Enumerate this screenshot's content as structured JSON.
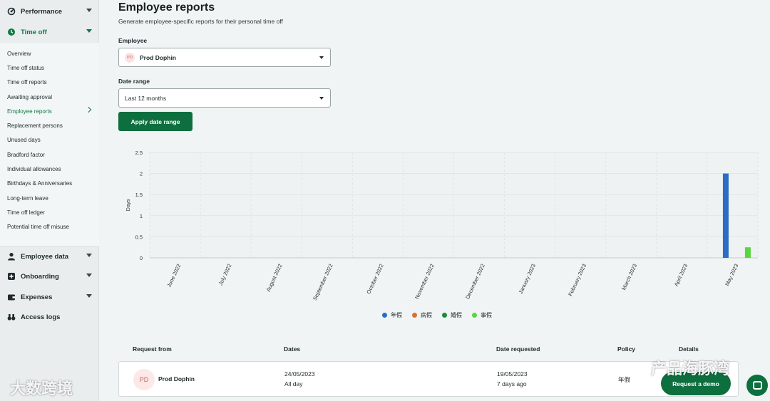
{
  "sidebar": {
    "sections_top": [
      {
        "label": "Performance",
        "icon": "performance-icon"
      },
      {
        "label": "Time off",
        "icon": "clock-icon"
      }
    ],
    "sub_items": [
      "Overview",
      "Time off status",
      "Time off reports",
      "Awaiting approval",
      "Employee reports",
      "Replacement persons",
      "Unused days",
      "Bradford factor",
      "Individual allowances",
      "Birthdays & Anniversaries",
      "Long-term leave",
      "Time off ledger",
      "Potential time off misuse"
    ],
    "active_sub_index": 4,
    "sections_bottom": [
      {
        "label": "Employee data",
        "icon": "person-icon"
      },
      {
        "label": "Onboarding",
        "icon": "plus-icon"
      },
      {
        "label": "Expenses",
        "icon": "wallet-icon"
      },
      {
        "label": "Access logs",
        "icon": "binoculars-icon"
      }
    ]
  },
  "page": {
    "title": "Employee reports",
    "subtitle": "Generate employee-specific reports for their personal time off"
  },
  "employee_field": {
    "label": "Employee",
    "avatar_initials": "PD",
    "value": "Prod Dophin"
  },
  "date_range_field": {
    "label": "Date range",
    "value": "Last 12 months"
  },
  "apply_button": "Apply date range",
  "chart_data": {
    "type": "bar",
    "ylabel": "Days",
    "ylim": [
      0,
      2.5
    ],
    "yticks": [
      "0",
      "0.5",
      "1",
      "1.5",
      "2",
      "2.5"
    ],
    "categories": [
      "June 2022",
      "July 2022",
      "August 2022",
      "September 2022",
      "October 2022",
      "November 2022",
      "December 2022",
      "January 2023",
      "February 2023",
      "March 2023",
      "April 2023",
      "May 2023"
    ],
    "series": [
      {
        "name": "年假",
        "color": "#2b6cc4",
        "values": [
          0,
          0,
          0,
          0,
          0,
          0,
          0,
          0,
          0,
          0,
          0,
          2
        ]
      },
      {
        "name": "病假",
        "color": "#d9702c",
        "values": [
          0,
          0,
          0,
          0,
          0,
          0,
          0,
          0,
          0,
          0,
          0,
          0
        ]
      },
      {
        "name": "婚假",
        "color": "#1c8a3c",
        "values": [
          0,
          0,
          0,
          0,
          0,
          0,
          0,
          0,
          0,
          0,
          0,
          0
        ]
      },
      {
        "name": "事假",
        "color": "#57d63e",
        "values": [
          0,
          0,
          0,
          0,
          0,
          0,
          0,
          0,
          0,
          0,
          0,
          0.25
        ]
      }
    ],
    "grid": true,
    "legend": "bottom"
  },
  "table": {
    "headers": [
      "Request from",
      "Dates",
      "Date requested",
      "Policy",
      "Details"
    ],
    "rows": [
      {
        "initials": "PD",
        "name": "Prod Dophin",
        "dates": "24/05/2023",
        "dates_sub": "All day",
        "requested": "19/05/2023",
        "requested_sub": "7 days ago",
        "policy": "年假"
      }
    ]
  },
  "demo_button": "Request a demo",
  "watermarks": {
    "left": "大数跨境",
    "right": "产品海豚湾"
  }
}
